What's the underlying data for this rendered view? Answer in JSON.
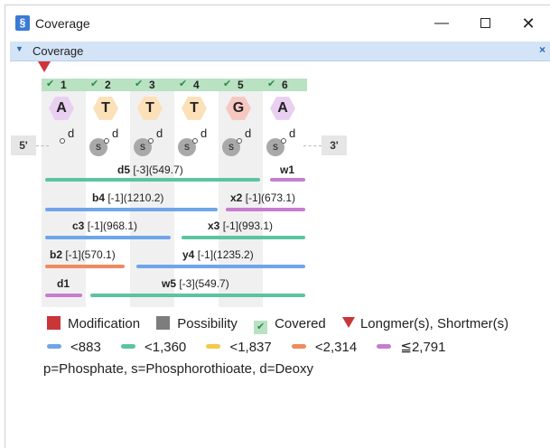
{
  "window": {
    "title": "Coverage",
    "app_icon": "sequence-app-icon"
  },
  "panel": {
    "title": "Coverage"
  },
  "columns": [
    {
      "num": "1",
      "base": "A"
    },
    {
      "num": "2",
      "base": "T"
    },
    {
      "num": "3",
      "base": "T"
    },
    {
      "num": "4",
      "base": "T"
    },
    {
      "num": "5",
      "base": "G"
    },
    {
      "num": "6",
      "base": "A"
    }
  ],
  "link_labels": {
    "d": "d",
    "s": "s"
  },
  "terminals": {
    "five_prime": "5'",
    "three_prime": "3'"
  },
  "fragments": [
    {
      "name": "d5",
      "detail": " [-3](549.7)",
      "color": "#5cc4a0"
    },
    {
      "name": "w1",
      "detail": "",
      "color": "#c77ccf"
    },
    {
      "name": "b4",
      "detail": " [-1](1210.2)",
      "color": "#6fa5ea"
    },
    {
      "name": "x2",
      "detail": " [-1](673.1)",
      "color": "#c77ccf"
    },
    {
      "name": "c3",
      "detail": " [-1](968.1)",
      "color": "#6fa5ea"
    },
    {
      "name": "x3",
      "detail": " [-1](993.1)",
      "color": "#5cc4a0"
    },
    {
      "name": "b2",
      "detail": " [-1](570.1)",
      "color": "#ef8b5f"
    },
    {
      "name": "y4",
      "detail": " [-1](1235.2)",
      "color": "#6fa5ea"
    },
    {
      "name": "d1",
      "detail": "",
      "color": "#c77ccf"
    },
    {
      "name": "w5",
      "detail": " [-3](549.7)",
      "color": "#5cc4a0"
    }
  ],
  "legend": {
    "modification": "Modification",
    "possibility": "Possibility",
    "covered": "Covered",
    "longmer": "Longmer(s), Shortmer(s)",
    "mass_ranges": [
      {
        "label": "<883",
        "color": "#6fa5ea"
      },
      {
        "label": "<1,360",
        "color": "#5cc4a0"
      },
      {
        "label": "<1,837",
        "color": "#f2cb4b"
      },
      {
        "label": "<2,314",
        "color": "#ef8b5f"
      },
      {
        "label": "≦2,791",
        "color": "#c77ccf"
      }
    ],
    "abbreviations": "p=Phosphate, s=Phosphorothioate, d=Deoxy"
  },
  "colors": {
    "modification": "#c9363a",
    "possibility": "#7d7d7d",
    "covered": "#b9e2c2",
    "panel_header": "#d3e4f6"
  }
}
